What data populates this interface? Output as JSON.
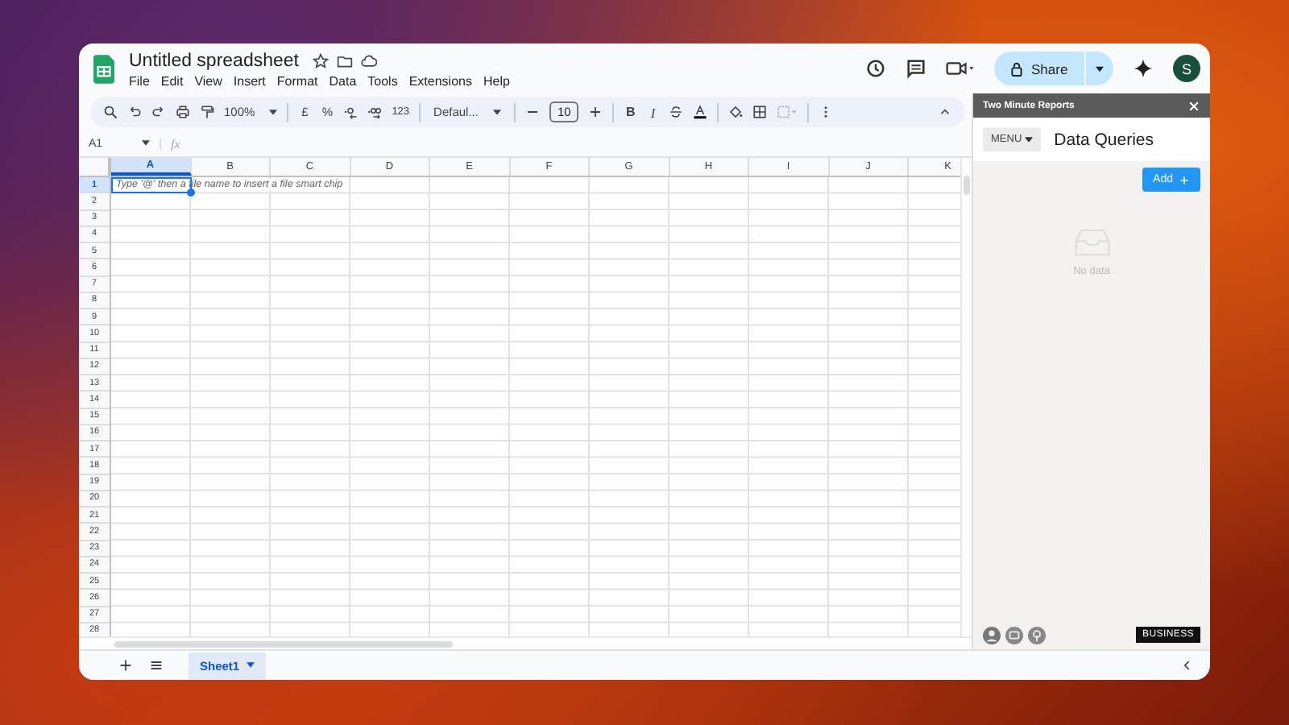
{
  "document": {
    "title": "Untitled spreadsheet"
  },
  "menu": [
    "File",
    "Edit",
    "View",
    "Insert",
    "Format",
    "Data",
    "Tools",
    "Extensions",
    "Help"
  ],
  "header": {
    "share_label": "Share",
    "avatar_letter": "S"
  },
  "toolbar": {
    "zoom": "100%",
    "currency": "£",
    "percent": "%",
    "number_format": "123",
    "font": "Defaul...",
    "font_size": "10",
    "bold": "B",
    "italic": "I"
  },
  "formula_bar": {
    "cell_ref": "A1",
    "fx": "fx"
  },
  "grid": {
    "columns": [
      {
        "label": "A",
        "selected": true
      },
      {
        "label": "B",
        "selected": false
      },
      {
        "label": "C",
        "selected": false
      },
      {
        "label": "D",
        "selected": false
      },
      {
        "label": "E",
        "selected": false
      },
      {
        "label": "F",
        "selected": false
      },
      {
        "label": "G",
        "selected": false
      },
      {
        "label": "H",
        "selected": false
      },
      {
        "label": "I",
        "selected": false
      },
      {
        "label": "J",
        "selected": false
      },
      {
        "label": "K",
        "selected": false
      }
    ],
    "rows": [
      {
        "label": "1",
        "selected": true
      },
      {
        "label": "2",
        "selected": false
      },
      {
        "label": "3",
        "selected": false
      },
      {
        "label": "4",
        "selected": false
      },
      {
        "label": "5",
        "selected": false
      },
      {
        "label": "6",
        "selected": false
      },
      {
        "label": "7",
        "selected": false
      },
      {
        "label": "8",
        "selected": false
      },
      {
        "label": "9",
        "selected": false
      },
      {
        "label": "10",
        "selected": false
      },
      {
        "label": "11",
        "selected": false
      },
      {
        "label": "12",
        "selected": false
      },
      {
        "label": "13",
        "selected": false
      },
      {
        "label": "14",
        "selected": false
      },
      {
        "label": "15",
        "selected": false
      },
      {
        "label": "16",
        "selected": false
      },
      {
        "label": "17",
        "selected": false
      },
      {
        "label": "18",
        "selected": false
      },
      {
        "label": "19",
        "selected": false
      },
      {
        "label": "20",
        "selected": false
      },
      {
        "label": "21",
        "selected": false
      },
      {
        "label": "22",
        "selected": false
      },
      {
        "label": "23",
        "selected": false
      },
      {
        "label": "24",
        "selected": false
      },
      {
        "label": "25",
        "selected": false
      },
      {
        "label": "26",
        "selected": false
      },
      {
        "label": "27",
        "selected": false
      },
      {
        "label": "28",
        "selected": false
      }
    ],
    "active_cell_hint": "Type '@' then a file name to insert a file smart chip"
  },
  "sheet_tabs": [
    {
      "label": "Sheet1",
      "selected": true
    }
  ],
  "side_panel": {
    "title": "Two Minute Reports",
    "menu_label": "MENU",
    "heading": "Data Queries",
    "add_label": "Add",
    "empty_text": "No data",
    "plan_badge": "BUSINESS"
  }
}
